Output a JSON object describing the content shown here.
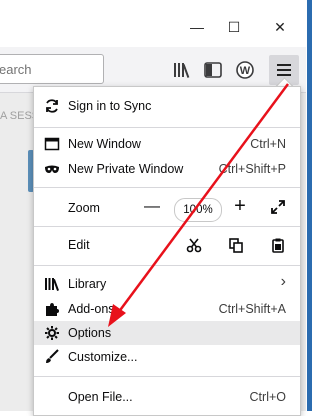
{
  "titlebar": {
    "window_controls": {
      "minimize": "—",
      "maximize": "☐",
      "close": "✕"
    }
  },
  "toolbar": {
    "search_placeholder": "earch",
    "icons": [
      "library-icon",
      "sidebar-icon",
      "extension-w-icon",
      "hamburger-menu-icon"
    ]
  },
  "page": {
    "tab_fragment": "A SESS"
  },
  "menu": {
    "sign_in": "Sign in to Sync",
    "new_window": {
      "label": "New Window",
      "shortcut": "Ctrl+N"
    },
    "new_private_window": {
      "label": "New Private Window",
      "shortcut": "Ctrl+Shift+P"
    },
    "zoom": {
      "label": "Zoom",
      "minus": "—",
      "value": "100%",
      "plus": "+"
    },
    "edit": {
      "label": "Edit"
    },
    "library": {
      "label": "Library",
      "chevron": "›"
    },
    "addons": {
      "label": "Add-ons",
      "shortcut": "Ctrl+Shift+A"
    },
    "options": {
      "label": "Options"
    },
    "customize": {
      "label": "Customize..."
    },
    "open_file": {
      "label": "Open File...",
      "shortcut": "Ctrl+O"
    }
  },
  "annotation": {
    "arrow_color": "#e8111b"
  },
  "colors": {
    "accent_edge": "#2b6cb0",
    "highlight": "#e9e9ea"
  }
}
